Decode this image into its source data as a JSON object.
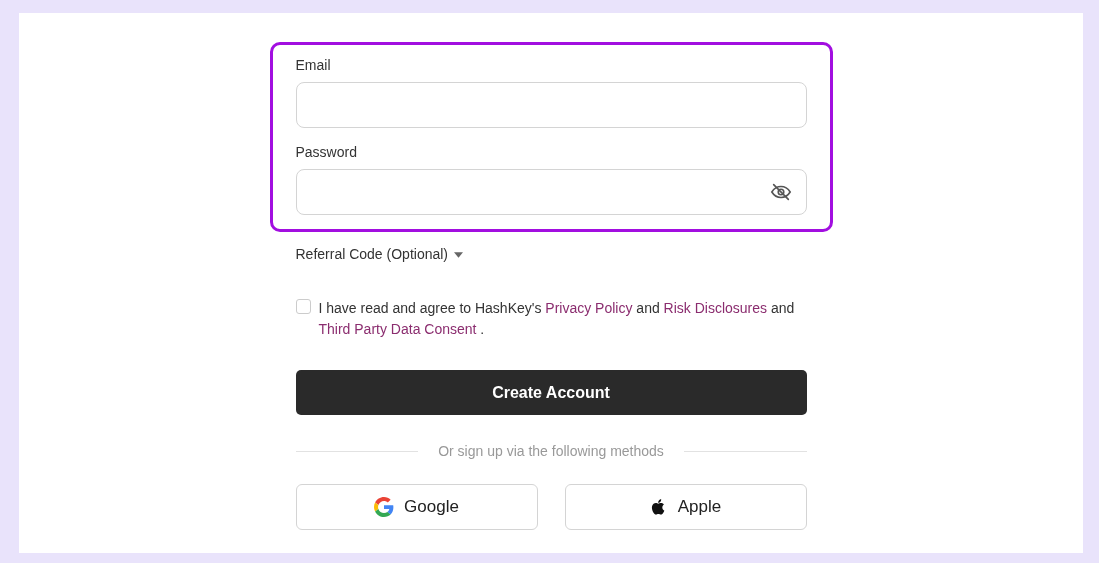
{
  "fields": [
    {
      "kind": "text",
      "label": "Email"
    },
    {
      "kind": "password",
      "label": "Password"
    }
  ],
  "highlighted": true,
  "referral": {
    "label": "Referral Code (Optional)",
    "expanded": false
  },
  "consent": {
    "checked": false,
    "parts": [
      {
        "kind": "text",
        "text": "I have read and agree to HashKey's "
      },
      {
        "kind": "link",
        "text": "Privacy Policy"
      },
      {
        "kind": "text",
        "text": " and "
      },
      {
        "kind": "link",
        "text": "Risk Disclosures"
      },
      {
        "kind": "text",
        "text": " and "
      },
      {
        "kind": "link",
        "text": "Third Party Data Consent"
      },
      {
        "kind": "text",
        "text": " ."
      }
    ]
  },
  "submit": "Create Account",
  "divider": "Or sign up via the following methods",
  "social": [
    {
      "kind": "google",
      "label": "Google"
    },
    {
      "kind": "apple",
      "label": "Apple"
    }
  ]
}
